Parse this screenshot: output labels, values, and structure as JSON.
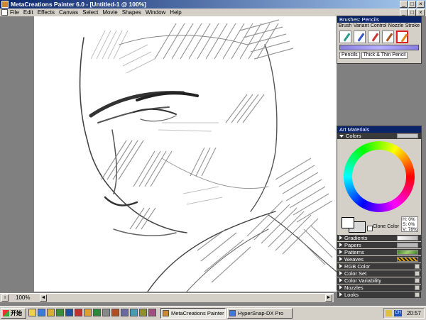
{
  "window": {
    "title": "MetaCreations Painter 6.0 - [Untitled-1 @ 100%]",
    "controls": [
      "_",
      "□",
      "×"
    ]
  },
  "menu": [
    "File",
    "Edit",
    "Effects",
    "Canvas",
    "Select",
    "Movie",
    "Shapes",
    "Window",
    "Help"
  ],
  "doc_controls": [
    "_",
    "□",
    "×"
  ],
  "status": {
    "zoom": "100%"
  },
  "brushes_palette": {
    "title": "Brushes: Pencils",
    "tabs": [
      "Brush",
      "Variant",
      "Control",
      "Nozzle",
      "Stroke"
    ],
    "icons": [
      {
        "name": "pencils-icon",
        "color": "#2a9d8f"
      },
      {
        "name": "pens-icon",
        "color": "#3355cc"
      },
      {
        "name": "chalk-icon",
        "color": "#cc3333"
      },
      {
        "name": "brush-icon",
        "color": "#aa5522"
      },
      {
        "name": "pencil-selected-icon",
        "color": "#dd8822"
      }
    ],
    "category": "Pencils",
    "variant": "Thick & Thin Pencil"
  },
  "art_materials": {
    "title": "Art Materials",
    "colors_label": "Colors",
    "clone_color": "Clone Color",
    "hsv": {
      "h": "H: 0%",
      "s": "S: 0%",
      "v": "V: 78%"
    },
    "sections": [
      {
        "label": "Gradients",
        "swatch": "linear-gradient(to right,#ffffff,#bbbbbb)"
      },
      {
        "label": "Papers",
        "swatch": "#b8b8b8"
      },
      {
        "label": "Patterns",
        "swatch": "linear-gradient(135deg,#3a7a2a,#a0d070,#3a7a2a)"
      },
      {
        "label": "Weaves",
        "swatch": "repeating-linear-gradient(45deg,#222 0 2px,#d9a400 2px 4px)"
      },
      {
        "label": "RGB Color",
        "swatch": ""
      },
      {
        "label": "Color Set",
        "swatch": ""
      },
      {
        "label": "Color Variability",
        "swatch": ""
      },
      {
        "label": "Nozzles",
        "swatch": ""
      },
      {
        "label": "Looks",
        "swatch": ""
      }
    ]
  },
  "taskbar": {
    "start": "开始",
    "tasks": [
      "MetaCreations Painter 6...",
      "HyperSnap-DX Pro"
    ],
    "clock": "20:57",
    "ime": "CH"
  }
}
